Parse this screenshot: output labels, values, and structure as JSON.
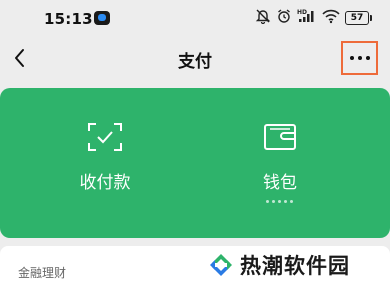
{
  "status_bar": {
    "time": "15:13",
    "battery": "57",
    "icons": [
      "app-notification-icon",
      "mute-icon",
      "alarm-icon",
      "hd-signal-icon",
      "wifi-icon",
      "battery-icon"
    ]
  },
  "nav": {
    "title": "支付",
    "back_icon": "chevron-left-icon",
    "more_icon": "more-icon"
  },
  "card": {
    "color": "#2eb36b",
    "items": [
      {
        "label": "收付款",
        "icon": "scan-qr-icon"
      },
      {
        "label": "钱包",
        "icon": "wallet-icon"
      }
    ]
  },
  "sections": {
    "finance_title": "金融理财"
  },
  "watermark": {
    "text": "热潮软件园"
  },
  "colors": {
    "highlight": "#ee6b3a",
    "background": "#ededed"
  }
}
